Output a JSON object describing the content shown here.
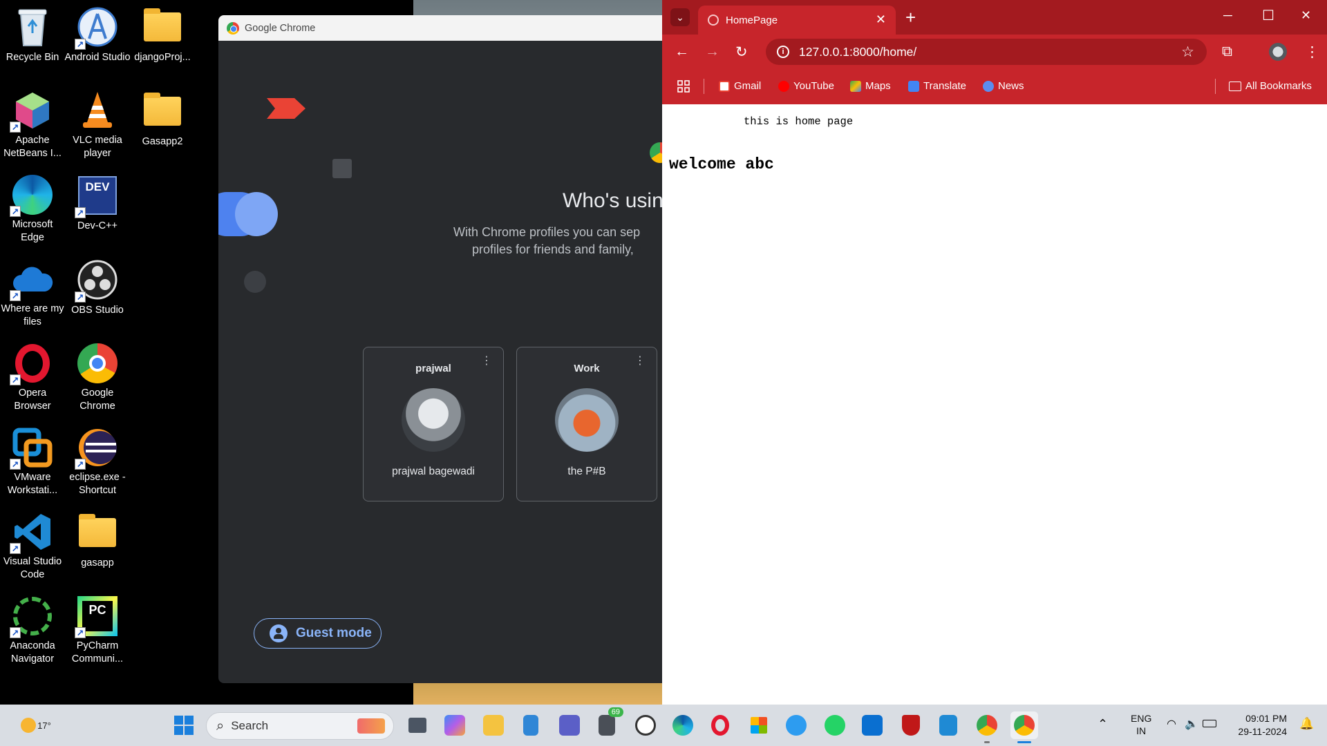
{
  "desktop": {
    "icons": [
      {
        "label": "Recycle Bin"
      },
      {
        "label": "Android Studio"
      },
      {
        "label": "djangoProj..."
      },
      {
        "label": "Apache NetBeans I..."
      },
      {
        "label": "VLC media player"
      },
      {
        "label": "Gasapp2"
      },
      {
        "label": "Microsoft Edge"
      },
      {
        "label": "Dev-C++"
      },
      {
        "label": "Where are my files"
      },
      {
        "label": "OBS Studio"
      },
      {
        "label": "Opera Browser"
      },
      {
        "label": "Google Chrome"
      },
      {
        "label": "VMware Workstati..."
      },
      {
        "label": "eclipse.exe - Shortcut"
      },
      {
        "label": "Visual Studio Code"
      },
      {
        "label": "gasapp"
      },
      {
        "label": "Anaconda Navigator"
      },
      {
        "label": "PyCharm Communi..."
      }
    ],
    "dev_badge": "DEV",
    "pc_badge": "PC"
  },
  "profile_window": {
    "title": "Google Chrome",
    "heading": "Who's usin",
    "subtitle_line1": "With Chrome profiles you can sep",
    "subtitle_line2": "profiles for friends and family,",
    "profiles": [
      {
        "name": "prajwal",
        "full_name": "prajwal bagewadi",
        "menu": "⋮"
      },
      {
        "name": "Work",
        "full_name": "the P#B",
        "menu": "⋮"
      }
    ],
    "guest_label": "Guest mode"
  },
  "chrome": {
    "tab_title": "HomePage",
    "tab_close": "✕",
    "new_tab": "+",
    "url": "127.0.0.1:8000/home/",
    "bookmarks": [
      {
        "label": "Gmail",
        "color": "#ea4335"
      },
      {
        "label": "YouTube",
        "color": "#ff0000"
      },
      {
        "label": "Maps",
        "color": "#34a853"
      },
      {
        "label": "Translate",
        "color": "#4285f4"
      },
      {
        "label": "News",
        "color": "#5b8def"
      }
    ],
    "all_bookmarks": "All Bookmarks",
    "page": {
      "line1": "this is home page",
      "line2": "welcome abc"
    }
  },
  "taskbar": {
    "weather": "17°",
    "search_placeholder": "Search",
    "teams_badge": "69",
    "lang_top": "ENG",
    "lang_bottom": "IN",
    "time": "09:01 PM",
    "date": "29-11-2024"
  },
  "colors": {
    "chrome_red": "#c7252b",
    "chrome_red_dark": "#a31a1f",
    "profile_bg": "#282a2d",
    "accent_blue": "#8ab4f8"
  }
}
